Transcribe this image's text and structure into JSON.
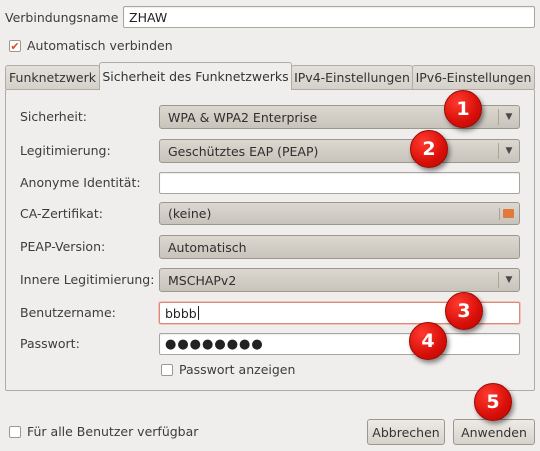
{
  "connection": {
    "name_label": "Verbindungsname",
    "name_value": "ZHAW",
    "auto_connect_label": "Automatisch verbinden",
    "auto_connect_checked": true
  },
  "tabs": [
    {
      "label": "Funknetzwerk"
    },
    {
      "label": "Sicherheit des Funknetzwerks"
    },
    {
      "label": "IPv4-Einstellungen"
    },
    {
      "label": "IPv6-Einstellungen"
    }
  ],
  "form": {
    "security": {
      "label": "Sicherheit:",
      "value": "WPA & WPA2 Enterprise"
    },
    "authentication": {
      "label": "Legitimierung:",
      "value": "Geschütztes EAP (PEAP)"
    },
    "anonymous_identity": {
      "label": "Anonyme Identität:",
      "value": ""
    },
    "ca_certificate": {
      "label": "CA-Zertifikat:",
      "value": "(keine)"
    },
    "peap_version": {
      "label": "PEAP-Version:",
      "value": "Automatisch"
    },
    "inner_auth": {
      "label": "Innere Legitimierung:",
      "value": "MSCHAPv2"
    },
    "username": {
      "label": "Benutzername:",
      "value": "bbbb"
    },
    "password": {
      "label": "Passwort:",
      "value": "●●●●●●●●"
    },
    "show_password_label": "Passwort anzeigen"
  },
  "footer": {
    "all_users_label": "Für alle Benutzer verfügbar",
    "cancel_label": "Abbrechen",
    "apply_label": "Anwenden"
  },
  "markers": [
    "1",
    "2",
    "3",
    "4",
    "5"
  ],
  "colors": {
    "marker": "#e0150c",
    "checkbox_check": "#d6521f",
    "dialog_bg": "#efeeec"
  }
}
